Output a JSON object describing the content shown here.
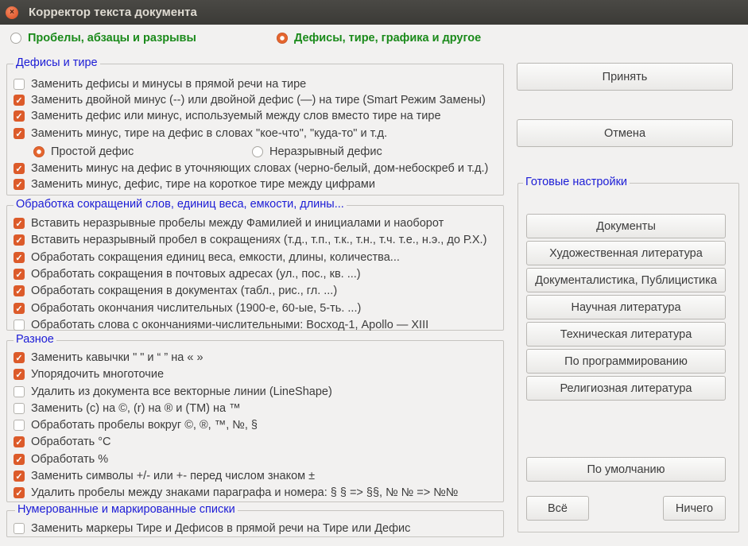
{
  "window": {
    "title": "Корректор текста документа",
    "close_icon": "close-icon"
  },
  "modes": [
    {
      "label": "Пробелы, абзацы и разрывы",
      "selected": false
    },
    {
      "label": "Дефисы, тире, графика и другое",
      "selected": true
    }
  ],
  "groups": {
    "hyphens": {
      "title": "Дефисы и тире",
      "items": [
        {
          "label": "Заменить дефисы и минусы в прямой речи на тире",
          "checked": false
        },
        {
          "label": "Заменить двойной минус (--) или двойной дефис (—) на тире (Smart Режим Замены)",
          "checked": true
        },
        {
          "label": "Заменить дефис или минус, используемый между слов вместо тире на тире",
          "checked": true
        },
        {
          "label": "Заменить минус, тире на дефис в словах \"кое-что\", \"куда-то\" и т.д.",
          "checked": true
        },
        {
          "label": "Заменить минус на дефис в уточняющих словах (черно-белый, дом-небоскреб и т.д.)",
          "checked": true
        },
        {
          "label": "Заменить минус, дефис, тире на короткое тире между цифрами",
          "checked": true
        }
      ],
      "hyphen_types": [
        {
          "label": "Простой дефис",
          "selected": true
        },
        {
          "label": "Неразрывный дефис",
          "selected": false
        }
      ]
    },
    "abbrev": {
      "title": "Обработка сокращений слов, единиц веса, емкости, длины...",
      "items": [
        {
          "label": "Вставить неразрывные пробелы между Фамилией и инициалами и наоборот",
          "checked": true
        },
        {
          "label": "Вставить неразрывный пробел в сокращениях (т.д., т.п., т.к., т.н., т.ч. т.е., н.э., до Р.Х.)",
          "checked": true
        },
        {
          "label": "Обработать сокращения единиц веса, емкости, длины, количества...",
          "checked": true
        },
        {
          "label": "Обработать сокращения в почтовых адресах (ул., пос., кв. ...)",
          "checked": true
        },
        {
          "label": "Обработать сокращения в документах (табл., рис., гл. ...)",
          "checked": true
        },
        {
          "label": "Обработать окончания числительных (1900-е, 60-ые, 5-ть. ...)",
          "checked": true
        },
        {
          "label": "Обработать слова с окончаниями-числительными: Восход-1, Apollo — XIII",
          "checked": false
        }
      ]
    },
    "misc": {
      "title": "Разное",
      "items": [
        {
          "label": "Заменить кавычки  \" \" и “ ” на  « »",
          "checked": true
        },
        {
          "label": "Упорядочить многоточие",
          "checked": true
        },
        {
          "label": "Удалить из документа все векторные линии (LineShape)",
          "checked": false
        },
        {
          "label": "Заменить (c) на ©, (r) на ® и (TM) на ™",
          "checked": false
        },
        {
          "label": "Обработать пробелы вокруг ©, ®, ™, №, §",
          "checked": false
        },
        {
          "label": "Обработать °C",
          "checked": true
        },
        {
          "label": "Обработать %",
          "checked": true
        },
        {
          "label": "Заменить символы +/- или +- перед числом знаком ±",
          "checked": true
        },
        {
          "label": "Удалить пробелы между знаками параграфа и номера: § § => §§, № № => №№",
          "checked": true
        }
      ]
    },
    "lists": {
      "title": "Нумерованные и маркированные списки",
      "items": [
        {
          "label": "Заменить маркеры Тире и Дефисов в прямой речи на Тире или Дефис",
          "checked": false
        }
      ]
    }
  },
  "actions": {
    "accept": "Принять",
    "cancel": "Отмена"
  },
  "presets": {
    "title": "Готовые настройки",
    "items": [
      "Документы",
      "Художественная литература",
      "Документалистика, Публицистика",
      "Научная литература",
      "Техническая литература",
      "По программированию",
      "Религиозная литература"
    ],
    "default": "По умолчанию",
    "all": "Всё",
    "none": "Ничего"
  }
}
